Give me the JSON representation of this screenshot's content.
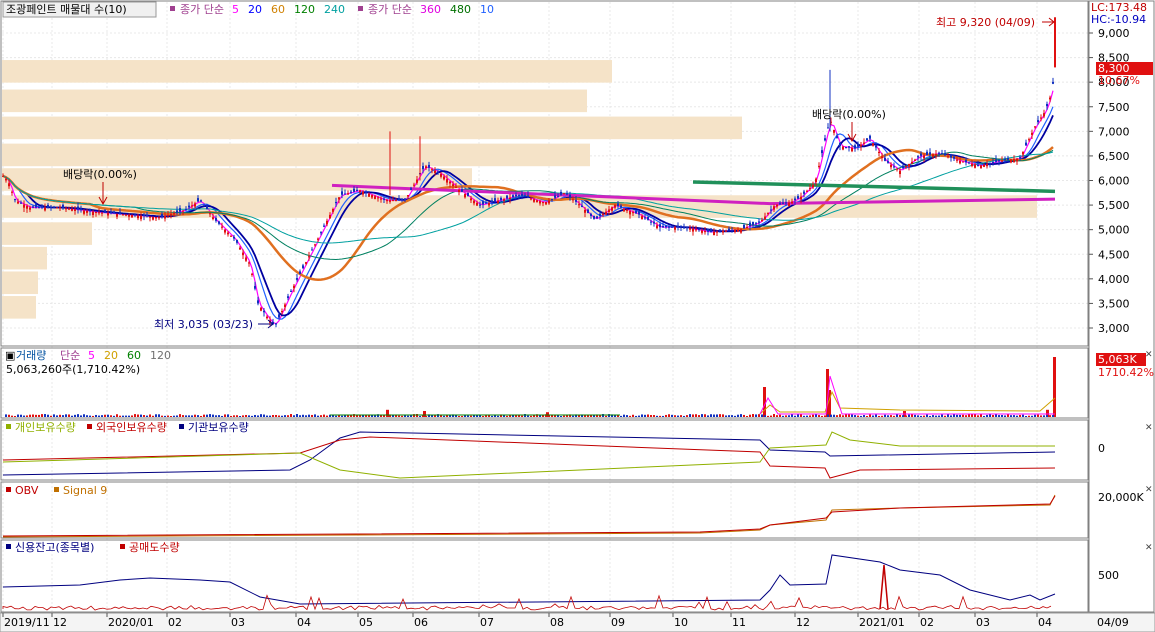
{
  "header": {
    "title": "조광페인트 매물대 수(10)",
    "ma_label": "종가 단순",
    "ma_periods": [
      "5",
      "20",
      "60",
      "120",
      "240"
    ],
    "ma_colors": [
      "#ff00ff",
      "#0000ff",
      "#d08000",
      "#008000",
      "#00a0a0"
    ],
    "ma2_label": "종가 단순",
    "ma2_periods": [
      "360",
      "480",
      "10"
    ],
    "ma2_colors": [
      "#e000e0",
      "#007000",
      "#2060ff"
    ]
  },
  "right_scale": {
    "lc": "LC:173.48",
    "hc": "HC:-10.94",
    "ticks": [
      "9,000",
      "8,500",
      "8,000",
      "7,500",
      "7,000",
      "6,500",
      "6,000",
      "5,500",
      "5,000",
      "4,500",
      "4,000",
      "3,500",
      "3,000"
    ],
    "last_price": "8,300",
    "last_change": "10.67%"
  },
  "annotations": {
    "high": "최고 9,320 (04/09)",
    "low": "최저 3,035 (03/23)",
    "dividend1": "배당락(0.00%)",
    "dividend2": "배당락(0.00%)"
  },
  "volume_panel": {
    "title": "거래량",
    "ma_label": "단순",
    "periods": [
      "5",
      "20",
      "60",
      "120"
    ],
    "colors": [
      "#ff00ff",
      "#d0a000",
      "#008000",
      "#707070"
    ],
    "value": "5,063,260주(1,710.42%)",
    "right_value": "5,063K",
    "right_pct": "1710.42%"
  },
  "holding_panel": {
    "legend": [
      "개인보유수량",
      "외국인보유수량",
      "기관보유수량"
    ],
    "colors": [
      "#90b000",
      "#c00000",
      "#000080"
    ],
    "scale": "0"
  },
  "obv_panel": {
    "legend": [
      "OBV",
      "Signal 9"
    ],
    "colors": [
      "#c00000",
      "#c07000"
    ],
    "scale": "20,000K"
  },
  "credit_panel": {
    "legend": [
      "신용잔고(종목별)",
      "공매도수량"
    ],
    "colors": [
      "#000080",
      "#c00000"
    ],
    "scale": "500"
  },
  "x_axis": {
    "labels": [
      "2019/11",
      "12",
      "2020/01",
      "02",
      "03",
      "04",
      "05",
      "06",
      "07",
      "08",
      "09",
      "10",
      "11",
      "12",
      "2021/01",
      "02",
      "03",
      "04"
    ],
    "right_label": "04/09"
  },
  "chart_data": {
    "type": "candlestick",
    "y_range": [
      2750,
      9400
    ],
    "price_path": [
      [
        0,
        6150
      ],
      [
        8,
        6000
      ],
      [
        15,
        5600
      ],
      [
        30,
        5450
      ],
      [
        60,
        5450
      ],
      [
        100,
        5350
      ],
      [
        130,
        5300
      ],
      [
        160,
        5250
      ],
      [
        185,
        5400
      ],
      [
        200,
        5600
      ],
      [
        215,
        5200
      ],
      [
        235,
        4800
      ],
      [
        250,
        4300
      ],
      [
        258,
        3500
      ],
      [
        268,
        3200
      ],
      [
        275,
        3035
      ],
      [
        290,
        3700
      ],
      [
        305,
        4300
      ],
      [
        320,
        4900
      ],
      [
        340,
        5700
      ],
      [
        360,
        5800
      ],
      [
        385,
        5600
      ],
      [
        405,
        5600
      ],
      [
        425,
        6300
      ],
      [
        440,
        6150
      ],
      [
        460,
        5800
      ],
      [
        480,
        5500
      ],
      [
        500,
        5600
      ],
      [
        520,
        5700
      ],
      [
        545,
        5550
      ],
      [
        565,
        5750
      ],
      [
        580,
        5500
      ],
      [
        595,
        5200
      ],
      [
        615,
        5500
      ],
      [
        640,
        5300
      ],
      [
        660,
        5050
      ],
      [
        685,
        5050
      ],
      [
        710,
        4950
      ],
      [
        740,
        5000
      ],
      [
        760,
        5150
      ],
      [
        775,
        5500
      ],
      [
        790,
        5550
      ],
      [
        800,
        5650
      ],
      [
        815,
        5950
      ],
      [
        830,
        7250
      ],
      [
        840,
        6700
      ],
      [
        855,
        6650
      ],
      [
        870,
        6850
      ],
      [
        885,
        6400
      ],
      [
        900,
        6200
      ],
      [
        920,
        6500
      ],
      [
        940,
        6550
      ],
      [
        960,
        6400
      ],
      [
        980,
        6300
      ],
      [
        1000,
        6400
      ],
      [
        1020,
        6450
      ],
      [
        1035,
        7100
      ],
      [
        1045,
        7400
      ],
      [
        1052,
        7800
      ],
      [
        1055,
        8300
      ]
    ],
    "volume_profile": [
      {
        "price": 8200,
        "length": 610
      },
      {
        "price": 7600,
        "length": 585
      },
      {
        "price": 7050,
        "length": 740
      },
      {
        "price": 6500,
        "length": 588
      },
      {
        "price": 6000,
        "length": 470
      },
      {
        "price": 5450,
        "length": 1035
      },
      {
        "price": 4900,
        "length": 90
      },
      {
        "price": 4400,
        "length": 45
      },
      {
        "price": 3900,
        "length": 36
      },
      {
        "price": 3400,
        "length": 34
      }
    ],
    "volume_spikes": [
      [
        765,
        0.5
      ],
      [
        828,
        0.8
      ],
      [
        830,
        0.45
      ],
      [
        1055,
        1.0
      ],
      [
        1048,
        0.12
      ],
      [
        388,
        0.12
      ],
      [
        425,
        0.1
      ],
      [
        548,
        0.08
      ],
      [
        905,
        0.1
      ]
    ],
    "high": {
      "x": 1055,
      "price": 9320
    },
    "low": {
      "x": 275,
      "price": 3035
    }
  }
}
